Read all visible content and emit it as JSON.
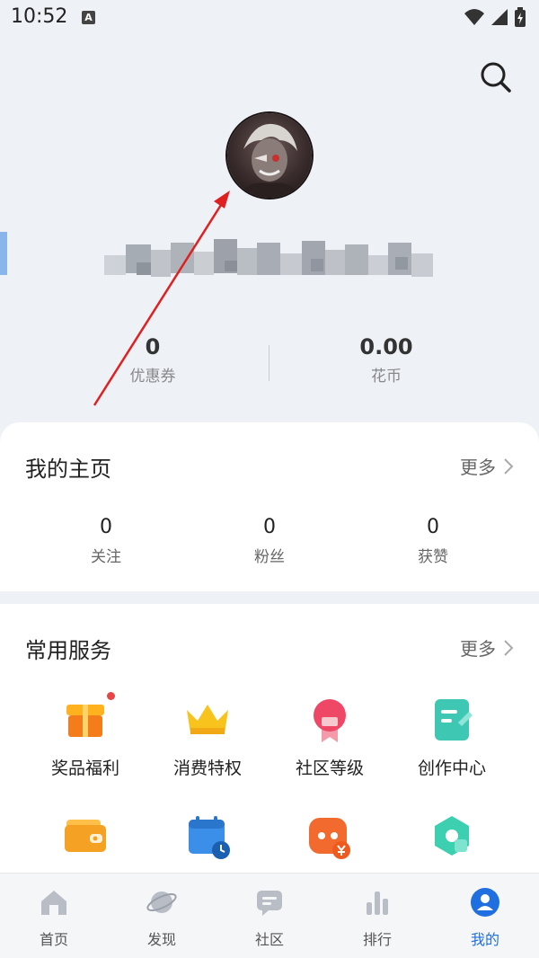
{
  "status_bar": {
    "time": "10:52",
    "notification_icon": "A"
  },
  "profile": {
    "stats": [
      {
        "value": "0",
        "label": "优惠券"
      },
      {
        "value": "0.00",
        "label": "花币"
      }
    ]
  },
  "my_home": {
    "title": "我的主页",
    "more": "更多",
    "stats": [
      {
        "value": "0",
        "label": "关注"
      },
      {
        "value": "0",
        "label": "粉丝"
      },
      {
        "value": "0",
        "label": "获赞"
      }
    ]
  },
  "services": {
    "title": "常用服务",
    "more": "更多",
    "items": [
      {
        "label": "奖品福利",
        "icon": "gift-icon",
        "color": "#f58a1f",
        "badge": true
      },
      {
        "label": "消费特权",
        "icon": "crown-icon",
        "color": "#f5c316"
      },
      {
        "label": "社区等级",
        "icon": "medal-icon",
        "color": "#ee4b6a"
      },
      {
        "label": "创作中心",
        "icon": "document-edit-icon",
        "color": "#3cc8b4"
      },
      {
        "label": "",
        "icon": "wallet-icon",
        "color": "#f5a623"
      },
      {
        "label": "",
        "icon": "calendar-icon",
        "color": "#3b8fe8"
      },
      {
        "label": "",
        "icon": "coin-bag-icon",
        "color": "#f26a2e"
      },
      {
        "label": "",
        "icon": "hexagon-icon",
        "color": "#3ccfb0"
      }
    ]
  },
  "bottom_nav": {
    "items": [
      {
        "label": "首页",
        "icon": "home-icon"
      },
      {
        "label": "发现",
        "icon": "planet-icon"
      },
      {
        "label": "社区",
        "icon": "chat-icon"
      },
      {
        "label": "排行",
        "icon": "bar-chart-icon"
      },
      {
        "label": "我的",
        "icon": "person-icon",
        "active": true
      }
    ]
  },
  "colors": {
    "accent": "#1f6fe0",
    "annotation_arrow": "#e02020",
    "header_bg": "#eef1f6"
  }
}
